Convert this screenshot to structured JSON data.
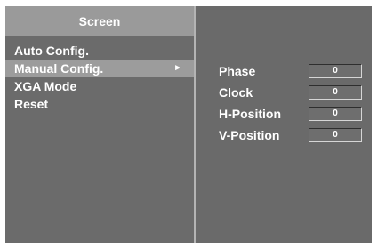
{
  "menu": {
    "title": "Screen",
    "items": [
      {
        "label": "Auto Config.",
        "selected": false
      },
      {
        "label": "Manual Config.",
        "selected": true,
        "arrow": "►"
      },
      {
        "label": "XGA Mode",
        "selected": false
      },
      {
        "label": "Reset",
        "selected": false
      }
    ]
  },
  "manual_config": {
    "params": [
      {
        "label": "Phase",
        "value": "0"
      },
      {
        "label": "Clock",
        "value": "0"
      },
      {
        "label": "H-Position",
        "value": "0"
      },
      {
        "label": "V-Position",
        "value": "0"
      }
    ]
  },
  "colors": {
    "panel": "#6b6b6b",
    "title_bar": "#9a9a9a",
    "selection": "#9c9c9c",
    "text": "#ffffff"
  }
}
